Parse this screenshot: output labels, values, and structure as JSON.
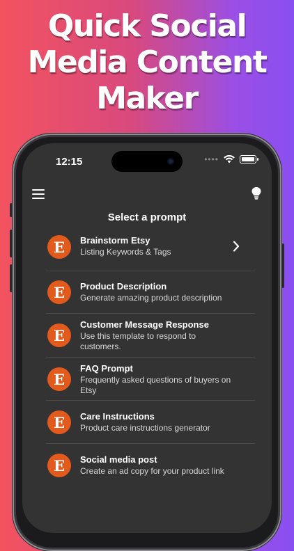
{
  "headline": [
    "Quick Social",
    "Media Content",
    "Maker"
  ],
  "status_bar": {
    "time": "12:15",
    "dots": "••••"
  },
  "toolbar": {
    "menu_icon": "hamburger-menu-icon",
    "right_icon": "lightbulb-icon"
  },
  "page_title": "Select a prompt",
  "prompts": [
    {
      "icon": "etsy-logo-icon",
      "logo_letter": "E",
      "title": "Brainstorm Etsy",
      "subtitle": "Listing Keywords & Tags",
      "has_chevron": true
    },
    {
      "icon": "etsy-logo-icon",
      "logo_letter": "E",
      "title": "Product Description",
      "subtitle": "Generate amazing product description"
    },
    {
      "icon": "etsy-logo-icon",
      "logo_letter": "E",
      "title": "Customer Message Response",
      "subtitle": "Use this template to respond to customers."
    },
    {
      "icon": "etsy-logo-icon",
      "logo_letter": "E",
      "title": "FAQ Prompt",
      "subtitle": "Frequently asked questions of buyers on Etsy"
    },
    {
      "icon": "etsy-logo-icon",
      "logo_letter": "E",
      "title": "Care Instructions",
      "subtitle": "Product care instructions generator"
    },
    {
      "icon": "etsy-logo-icon",
      "logo_letter": "E",
      "title": "Social media post",
      "subtitle": "Create an ad copy for your product link"
    }
  ],
  "colors": {
    "etsy_orange": "#e25a1c",
    "screen_bg": "#333333",
    "gradient_left": "#f3535f",
    "gradient_right": "#8a4ff0"
  }
}
